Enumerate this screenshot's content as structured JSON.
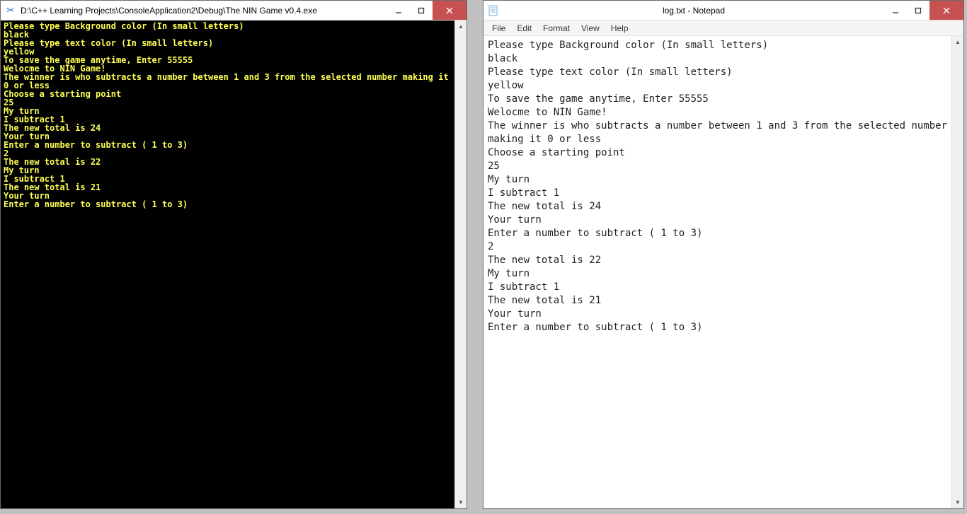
{
  "console": {
    "title": "D:\\C++ Learning Projects\\ConsoleApplication2\\Debug\\The NIN Game v0.4.exe",
    "icon_name": "scissors-icon",
    "lines": [
      "Please type Background color (In small letters)",
      "black",
      "Please type text color (In small letters)",
      "yellow",
      "To save the game anytime, Enter 55555",
      "Welocme to NIN Game!",
      "The winner is who subtracts a number between 1 and 3 from the selected number making it 0 or less",
      "Choose a starting point",
      "25",
      "My turn",
      "I subtract 1",
      "The new total is 24",
      "Your turn",
      "Enter a number to subtract ( 1 to 3)",
      "2",
      "The new total is 22",
      "My turn",
      "I subtract 1",
      "The new total is 21",
      "Your turn",
      "Enter a number to subtract ( 1 to 3)"
    ]
  },
  "notepad": {
    "title": "log.txt - Notepad",
    "icon_name": "notepad-icon",
    "menu": {
      "file": "File",
      "edit": "Edit",
      "format": "Format",
      "view": "View",
      "help": "Help"
    },
    "lines": [
      "Please type Background color (In small letters)",
      "black",
      "Please type text color (In small letters)",
      "yellow",
      "To save the game anytime, Enter 55555",
      "Welocme to NIN Game!",
      "The winner is who subtracts a number between 1 and 3 from the selected number making it 0 or less",
      "Choose a starting point",
      "25",
      "My turn",
      "I subtract 1",
      "The new total is 24",
      "Your turn",
      "Enter a number to subtract ( 1 to 3)",
      "2",
      "The new total is 22",
      "My turn",
      "I subtract 1",
      "The new total is 21",
      "Your turn",
      "Enter a number to subtract ( 1 to 3)"
    ]
  },
  "window_controls": {
    "minimize": "minimize",
    "maximize": "maximize",
    "close": "close"
  }
}
